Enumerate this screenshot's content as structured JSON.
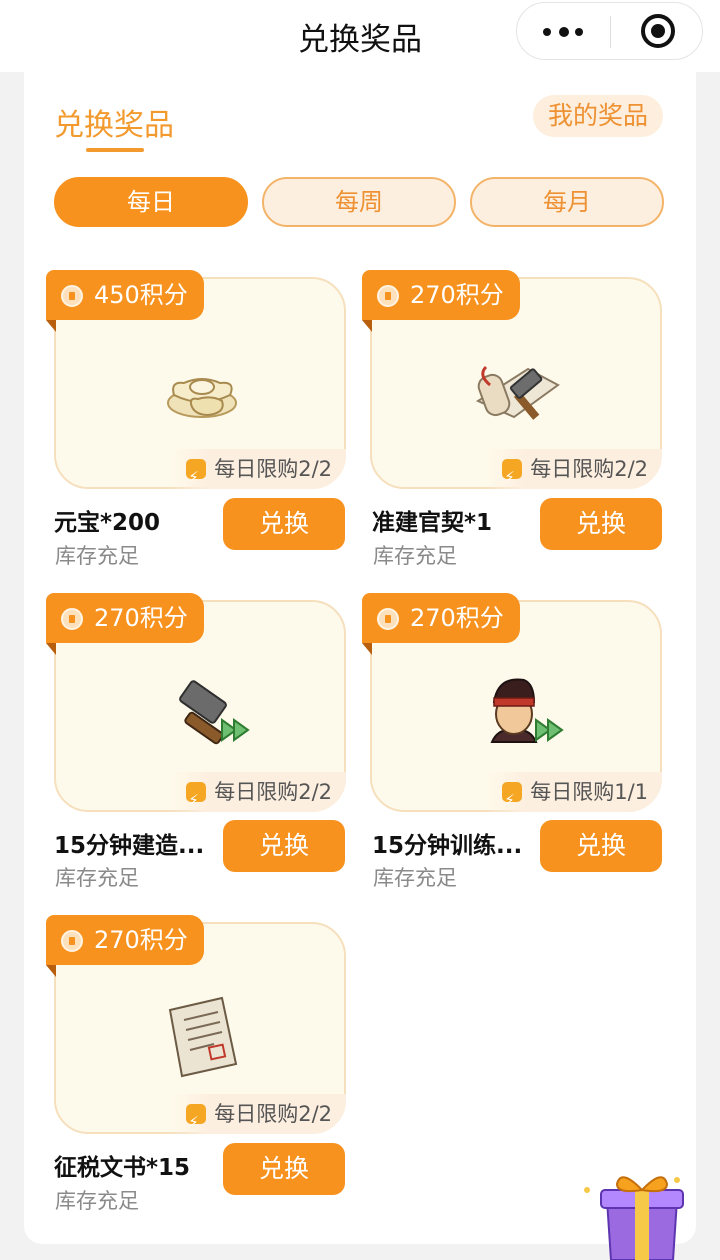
{
  "nav": {
    "title": "兑换奖品"
  },
  "header": {
    "exchange_title": "兑换奖品",
    "my_prizes": "我的奖品"
  },
  "tabs": [
    {
      "label": "每日",
      "active": true
    },
    {
      "label": "每周",
      "active": false
    },
    {
      "label": "每月",
      "active": false
    }
  ],
  "items": [
    {
      "price": "450积分",
      "limit": "每日限购2/2",
      "name": "元宝*200",
      "stock": "库存充足",
      "button": "兑换",
      "icon": "gold-ingot-icon"
    },
    {
      "price": "270积分",
      "limit": "每日限购2/2",
      "name": "准建官契*1",
      "stock": "库存充足",
      "button": "兑换",
      "icon": "scroll-hammer-icon"
    },
    {
      "price": "270积分",
      "limit": "每日限购2/2",
      "name": "15分钟建造...",
      "stock": "库存充足",
      "button": "兑换",
      "icon": "hammer-speedup-icon"
    },
    {
      "price": "270积分",
      "limit": "每日限购1/1",
      "name": "15分钟训练...",
      "stock": "库存充足",
      "button": "兑换",
      "icon": "soldier-speedup-icon"
    },
    {
      "price": "270积分",
      "limit": "每日限购2/2",
      "name": "征税文书*15",
      "stock": "库存充足",
      "button": "兑换",
      "icon": "tax-document-icon"
    }
  ],
  "colors": {
    "accent": "#f7921e",
    "accent_light": "#fdefe0",
    "card_bg": "#fefaeb"
  },
  "floating": {
    "icon": "gift-box-icon"
  }
}
